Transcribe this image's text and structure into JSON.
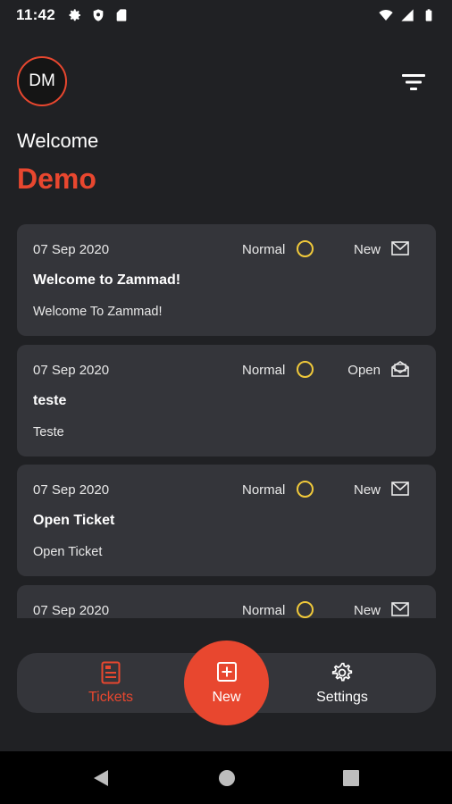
{
  "status_bar": {
    "time": "11:42",
    "left_icons": [
      "gear-icon",
      "shield-icon",
      "sim-card-icon"
    ],
    "right_icons": [
      "wifi-icon",
      "signal-icon",
      "battery-icon"
    ]
  },
  "header": {
    "avatar_initials": "DM",
    "welcome": "Welcome",
    "user_name": "Demo",
    "filter_icon": "filter-icon"
  },
  "tickets": [
    {
      "date": "07 Sep 2020",
      "priority": "Normal",
      "state": "New",
      "state_icon": "envelope-closed-icon",
      "title": "Welcome to Zammad!",
      "body": "Welcome To Zammad!"
    },
    {
      "date": "07 Sep 2020",
      "priority": "Normal",
      "state": "Open",
      "state_icon": "envelope-open-icon",
      "title": "teste",
      "body": "Teste"
    },
    {
      "date": "07 Sep 2020",
      "priority": "Normal",
      "state": "New",
      "state_icon": "envelope-closed-icon",
      "title": "Open Ticket",
      "body": "Open Ticket"
    },
    {
      "date": "07 Sep 2020",
      "priority": "Normal",
      "state": "New",
      "state_icon": "envelope-closed-icon",
      "title": "",
      "body": ""
    }
  ],
  "bottom_nav": {
    "tickets_label": "Tickets",
    "new_label": "New",
    "settings_label": "Settings"
  },
  "colors": {
    "accent": "#e8472f",
    "background": "#202124",
    "card": "#34353a",
    "priority_normal": "#f0c93a"
  }
}
